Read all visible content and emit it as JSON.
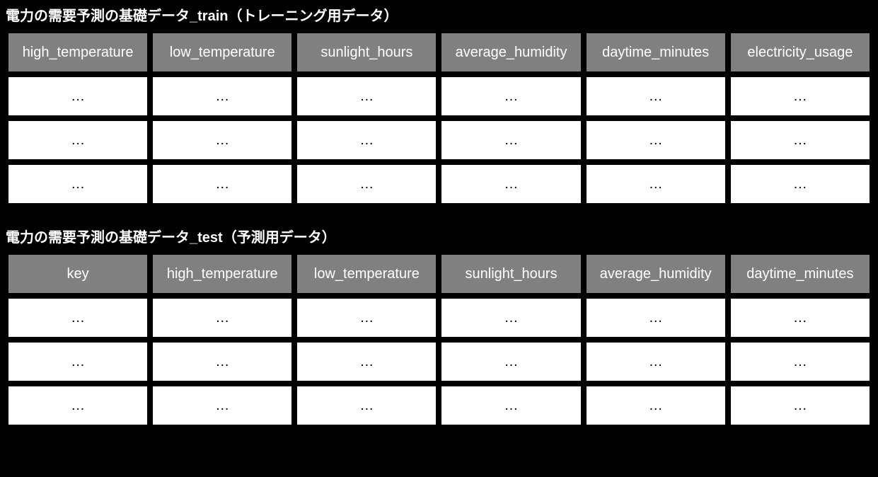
{
  "tables": [
    {
      "title": "電力の需要予測の基礎データ_train（トレーニング用データ）",
      "columns": [
        "high_temperature",
        "low_temperature",
        "sunlight_hours",
        "average_humidity",
        "daytime_minutes",
        "electricity_usage"
      ],
      "rows": [
        [
          "…",
          "…",
          "…",
          "…",
          "…",
          "…"
        ],
        [
          "…",
          "…",
          "…",
          "…",
          "…",
          "…"
        ],
        [
          "…",
          "…",
          "…",
          "…",
          "…",
          "…"
        ]
      ]
    },
    {
      "title": "電力の需要予測の基礎データ_test（予測用データ）",
      "columns": [
        "key",
        "high_temperature",
        "low_temperature",
        "sunlight_hours",
        "average_humidity",
        "daytime_minutes"
      ],
      "rows": [
        [
          "…",
          "…",
          "…",
          "…",
          "…",
          "…"
        ],
        [
          "…",
          "…",
          "…",
          "…",
          "…",
          "…"
        ],
        [
          "…",
          "…",
          "…",
          "…",
          "…",
          "…"
        ]
      ]
    }
  ]
}
